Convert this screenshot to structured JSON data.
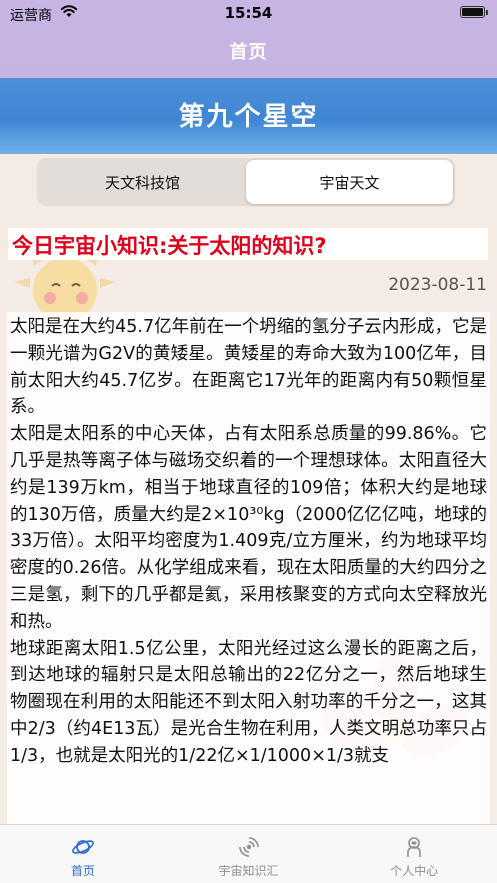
{
  "status_bar": {
    "carrier": "运营商",
    "time": "15:54"
  },
  "nav": {
    "title": "首页"
  },
  "banner": {
    "title": "第九个星空"
  },
  "segment": {
    "items": [
      "天文科技馆",
      "宇宙天文"
    ],
    "selected": "宇宙天文"
  },
  "article": {
    "headline": "今日宇宙小知识:关于太阳的知识?",
    "date": "2023-08-11",
    "paragraphs": [
      "太阳是在大约45.7亿年前在一个坍缩的氢分子云内形成，它是一颗光谱为G2V的黄矮星。黄矮星的寿命大致为100亿年，目前太阳大约45.7亿岁。在距离它17光年的距离内有50颗恒星系。",
      "太阳是太阳系的中心天体，占有太阳系总质量的99.86%。它几乎是热等离子体与磁场交织着的一个理想球体。太阳直径大约是139万km，相当于地球直径的109倍；体积大约是地球的130万倍，质量大约是2×10³⁰kg（2000亿亿亿吨，地球的33万倍）。太阳平均密度为1.409克/立方厘米，约为地球平均密度的0.26倍。从化学组成来看，现在太阳质量的大约四分之三是氢，剩下的几乎都是氦，采用核聚变的方式向太空释放光和热。",
      "地球距离太阳1.5亿公里，太阳光经过这么漫长的距离之后，到达地球的辐射只是太阳总输出的22亿分之一，然后地球生物圈现在利用的太阳能还不到太阳入射功率的千分之一，这其中2/3（约4E13瓦）是光合生物在利用，人类文明总功率只占1/3，也就是太阳光的1/22亿×1/1000×1/3就支"
    ]
  },
  "tabbar": {
    "items": [
      {
        "label": "首页",
        "icon": "planet-icon",
        "active": true
      },
      {
        "label": "宇宙知识汇",
        "icon": "galaxy-icon",
        "active": false
      },
      {
        "label": "个人中心",
        "icon": "astronaut-icon",
        "active": false
      }
    ]
  },
  "colors": {
    "nav_bg": "#c8b5e3",
    "banner_bg": "#4b8fd6",
    "headline": "#e0001a",
    "tab_active": "#2b6cd6",
    "tab_inactive": "#8e8e93"
  }
}
